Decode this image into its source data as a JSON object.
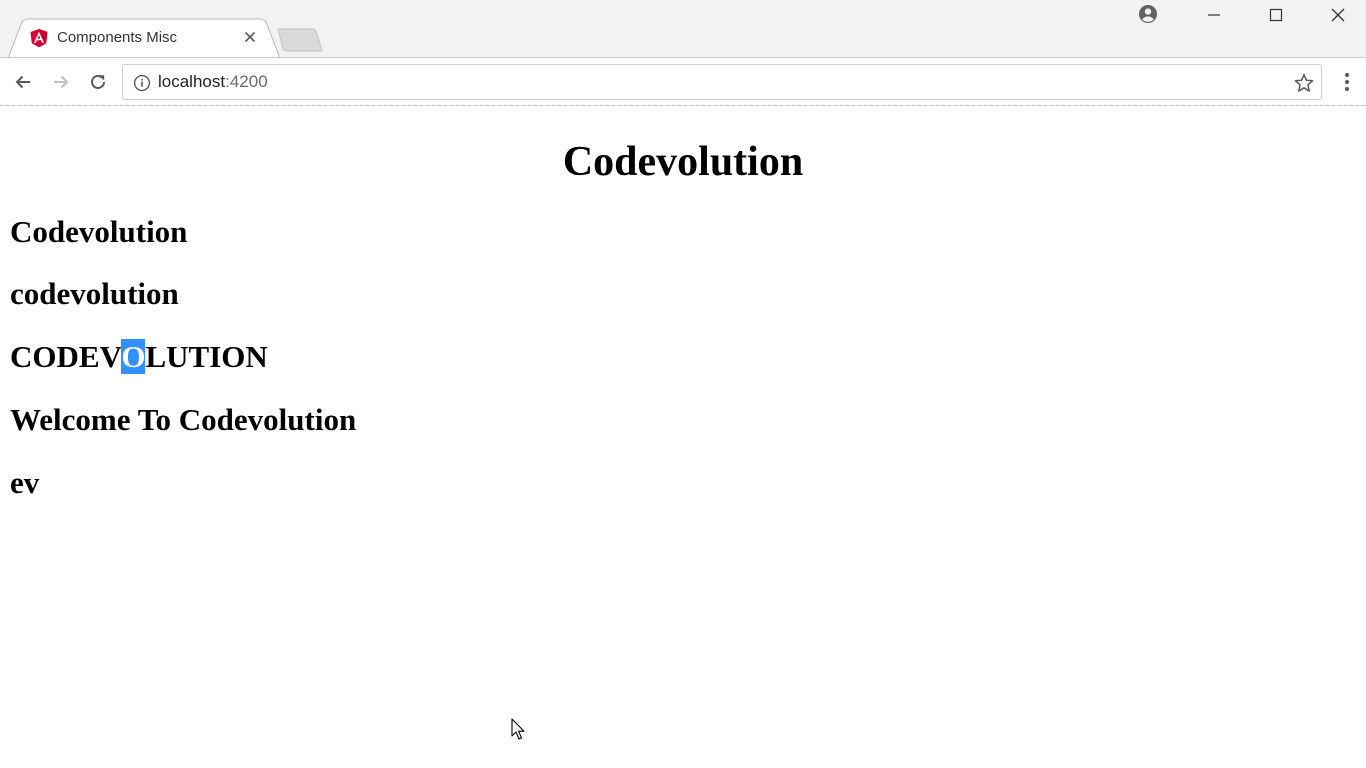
{
  "window": {
    "tab": {
      "title": "Components Misc",
      "favicon": "angular-logo-icon",
      "close_icon": "close-icon"
    },
    "new_tab_icon": "new-tab-icon",
    "controls": [
      "profile-icon",
      "minimize-icon",
      "maximize-icon",
      "close-icon"
    ]
  },
  "toolbar": {
    "back_icon": "arrow-left-icon",
    "forward_icon": "arrow-right-icon",
    "reload_icon": "reload-icon",
    "address": {
      "host": "localhost",
      "port": ":4200",
      "security_icon": "info-icon"
    },
    "bookmark_icon": "star-icon",
    "menu_icon": "more-vertical-icon"
  },
  "page": {
    "title": "Codevolution",
    "lines": {
      "titlecase": "Codevolution",
      "lowercase": "codevolution",
      "uppercase_before": "CODEV",
      "uppercase_selected": "O",
      "uppercase_after": "LUTION",
      "welcome": "Welcome To Codevolution",
      "slice": "ev"
    }
  },
  "colors": {
    "selection": "#3390ff",
    "angular_red": "#dd0031"
  }
}
